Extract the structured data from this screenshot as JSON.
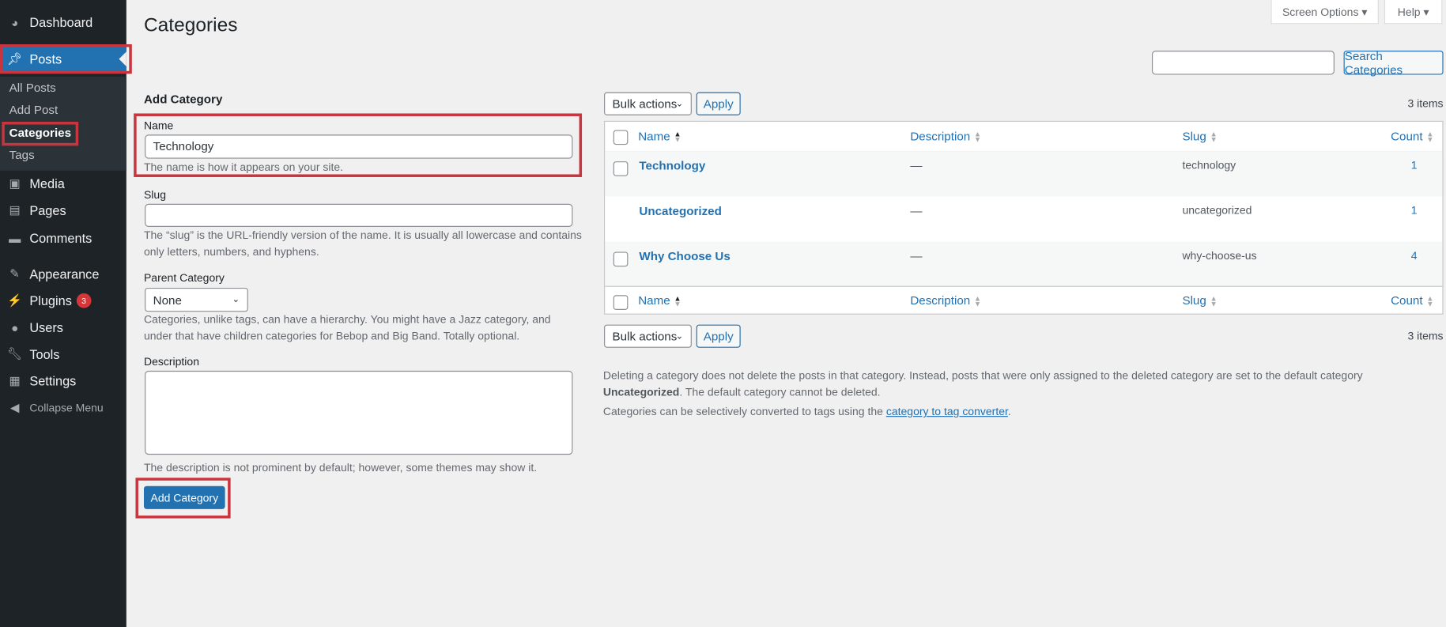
{
  "sidebar": {
    "items": [
      {
        "label": "Dashboard",
        "icon": "dashboard-icon"
      },
      {
        "label": "Posts",
        "icon": "pin-icon"
      },
      {
        "label": "Media",
        "icon": "media-icon"
      },
      {
        "label": "Pages",
        "icon": "pages-icon"
      },
      {
        "label": "Comments",
        "icon": "comments-icon"
      },
      {
        "label": "Appearance",
        "icon": "brush-icon"
      },
      {
        "label": "Plugins",
        "icon": "plugin-icon",
        "badge": "3"
      },
      {
        "label": "Users",
        "icon": "users-icon"
      },
      {
        "label": "Tools",
        "icon": "wrench-icon"
      },
      {
        "label": "Settings",
        "icon": "settings-icon"
      },
      {
        "label": "Collapse Menu",
        "icon": "collapse-icon"
      }
    ],
    "submenu": [
      "All Posts",
      "Add Post",
      "Categories",
      "Tags"
    ]
  },
  "header": {
    "title": "Categories",
    "screen_options": "Screen Options ▾",
    "help": "Help ▾"
  },
  "search": {
    "value": "",
    "button": "Search Categories"
  },
  "form": {
    "heading": "Add Category",
    "name_label": "Name",
    "name_value": "Technology",
    "name_help": "The name is how it appears on your site.",
    "slug_label": "Slug",
    "slug_value": "",
    "slug_help": "The “slug” is the URL-friendly version of the name. It is usually all lowercase and contains only letters, numbers, and hyphens.",
    "parent_label": "Parent Category",
    "parent_value": "None",
    "parent_help": "Categories, unlike tags, can have a hierarchy. You might have a Jazz category, and under that have children categories for Bebop and Big Band. Totally optional.",
    "desc_label": "Description",
    "desc_value": "",
    "desc_help": "The description is not prominent by default; however, some themes may show it.",
    "submit": "Add Category"
  },
  "table": {
    "bulk_label": "Bulk actions",
    "apply": "Apply",
    "items_count": "3 items",
    "columns": [
      "Name",
      "Description",
      "Slug",
      "Count"
    ],
    "rows": [
      {
        "name": "Technology",
        "description": "—",
        "slug": "technology",
        "count": "1"
      },
      {
        "name": "Uncategorized",
        "description": "—",
        "slug": "uncategorized",
        "count": "1"
      },
      {
        "name": "Why Choose Us",
        "description": "—",
        "slug": "why-choose-us",
        "count": "4"
      }
    ]
  },
  "notes": {
    "line1_a": "Deleting a category does not delete the posts in that category. Instead, posts that were only assigned to the deleted category are set to the default category ",
    "line1_bold": "Uncategorized",
    "line1_b": ". The default category cannot be deleted.",
    "line2_a": "Categories can be selectively converted to tags using the ",
    "line2_link": "category to tag converter",
    "line2_b": "."
  },
  "colors": {
    "accent": "#2271b1",
    "sidebar": "#1d2327",
    "highlight": "#c9353f"
  }
}
